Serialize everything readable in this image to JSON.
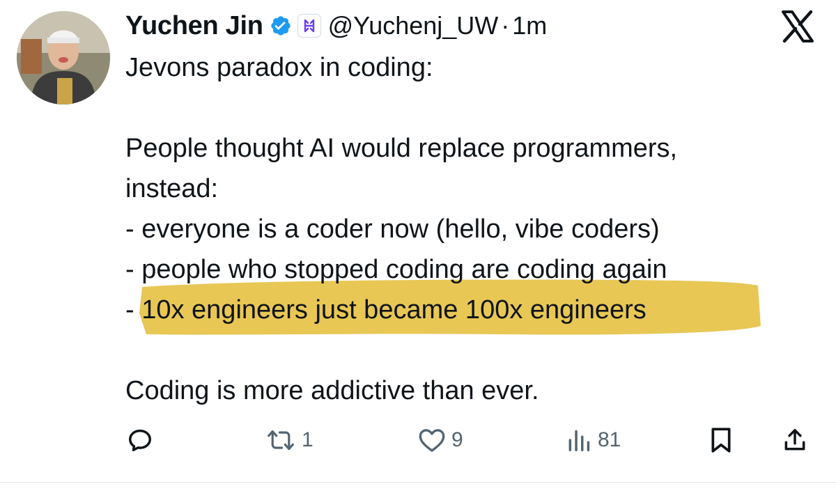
{
  "author": {
    "name": "Yuchen Jin",
    "handle": "@Yuchenj_UW",
    "separator": "·",
    "timestamp": "1m"
  },
  "tweet": {
    "lines": [
      "Jevons paradox in coding:",
      "",
      "People thought AI would replace programmers,",
      "instead:",
      "- everyone is a coder now (hello, vibe coders)",
      "- people who stopped coding are coding again",
      "- 10x engineers just became 100x engineers",
      "",
      "Coding is more addictive than ever."
    ],
    "highlight_color": "#e6c247"
  },
  "actions": {
    "reply_count": "",
    "retweet_count": "1",
    "like_count": "9",
    "view_count": "81"
  },
  "colors": {
    "text": "#0f1419",
    "secondary": "#536471",
    "verified": "#1d9bf0",
    "badge": "#6b3df5"
  },
  "icons": [
    "verified-icon",
    "affiliate-badge-icon",
    "x-logo-icon",
    "reply-icon",
    "retweet-icon",
    "like-icon",
    "views-icon",
    "bookmark-icon",
    "share-icon"
  ]
}
